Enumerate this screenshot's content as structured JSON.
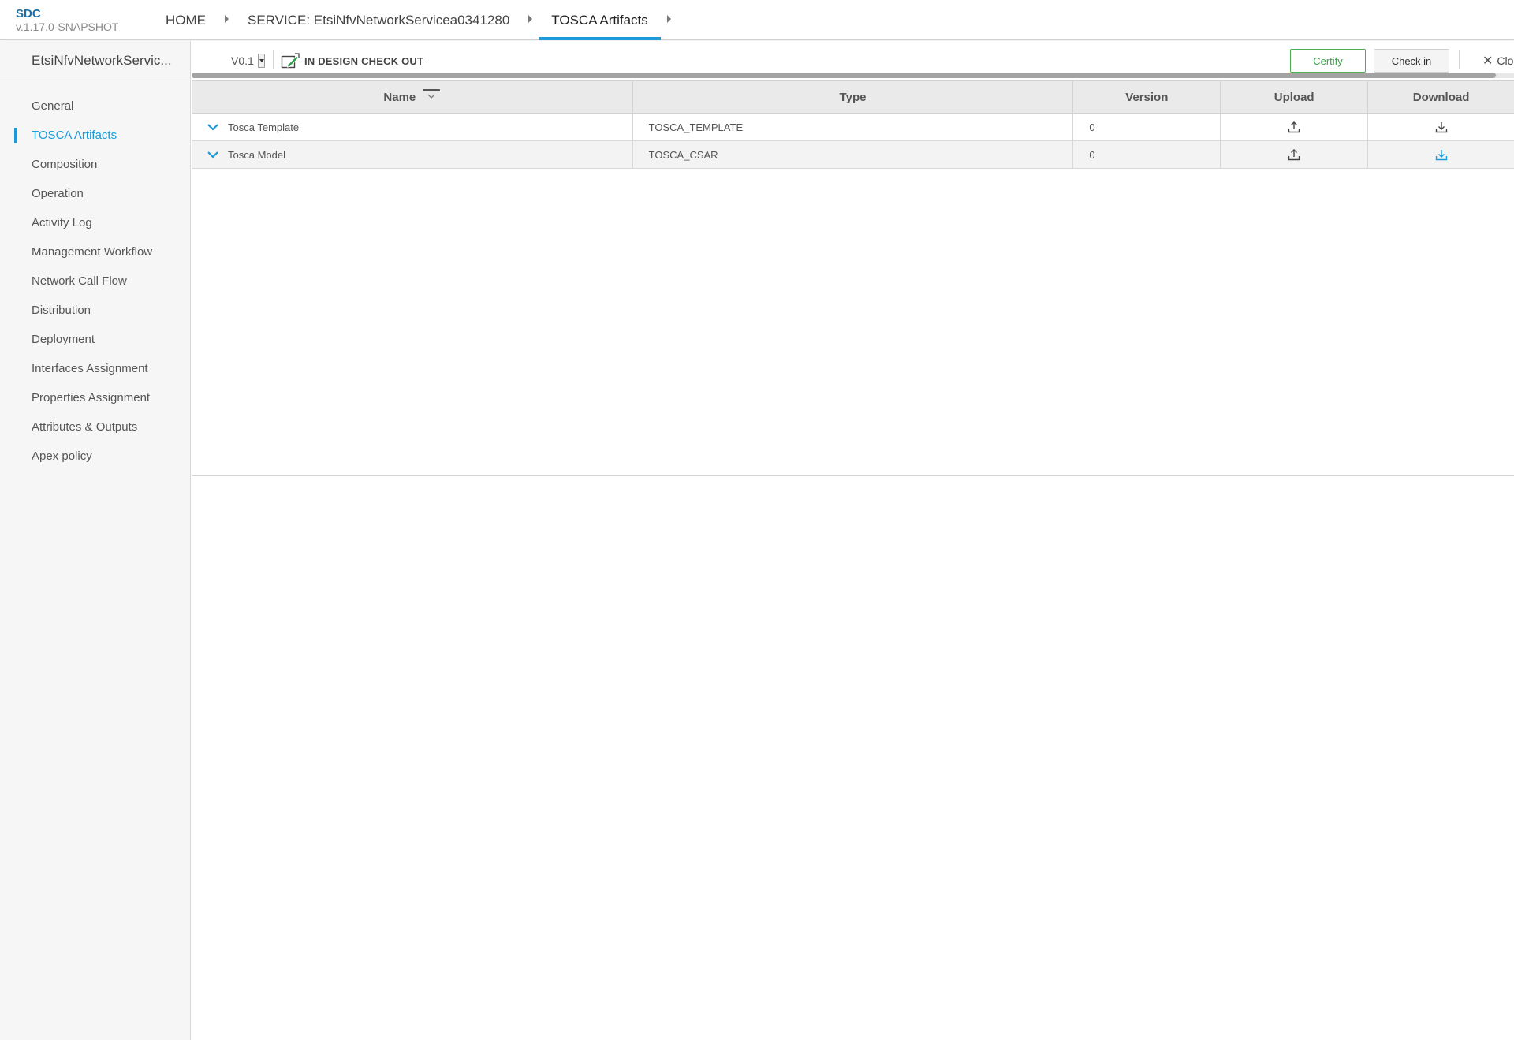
{
  "app": {
    "name": "SDC",
    "version": "v.1.17.0-SNAPSHOT"
  },
  "breadcrumb": [
    {
      "label": "HOME"
    },
    {
      "label": "SERVICE: EtsiNfvNetworkServicea0341280"
    },
    {
      "label": "TOSCA Artifacts",
      "active": true
    }
  ],
  "sidebar": {
    "title": "EtsiNfvNetworkServic...",
    "items": [
      {
        "label": "General"
      },
      {
        "label": "TOSCA Artifacts",
        "selected": true
      },
      {
        "label": "Composition"
      },
      {
        "label": "Operation"
      },
      {
        "label": "Activity Log"
      },
      {
        "label": "Management Workflow"
      },
      {
        "label": "Network Call Flow"
      },
      {
        "label": "Distribution"
      },
      {
        "label": "Deployment"
      },
      {
        "label": "Interfaces Assignment"
      },
      {
        "label": "Properties Assignment"
      },
      {
        "label": "Attributes & Outputs"
      },
      {
        "label": "Apex policy"
      }
    ]
  },
  "toolbar": {
    "version_value": "V0.1",
    "status_label": "IN DESIGN CHECK OUT",
    "certify_label": "Certify",
    "checkin_label": "Check in",
    "close_label": "Clo"
  },
  "table": {
    "headers": {
      "name": "Name",
      "type": "Type",
      "version": "Version",
      "upload": "Upload",
      "download": "Download"
    },
    "rows": [
      {
        "name": "Tosca Template",
        "type": "TOSCA_TEMPLATE",
        "version": "0"
      },
      {
        "name": "Tosca Model",
        "type": "TOSCA_CSAR",
        "version": "0"
      }
    ]
  },
  "icons": {
    "expand": "chevron-down-icon",
    "upload": "upload-icon",
    "download": "download-icon",
    "sort": "sort-desc-icon",
    "status": "edit-checkout-icon",
    "close": "close-icon"
  },
  "colors": {
    "accent": "#1a9bd7",
    "certify": "#3ea24a",
    "brand": "#1f6fa6"
  }
}
